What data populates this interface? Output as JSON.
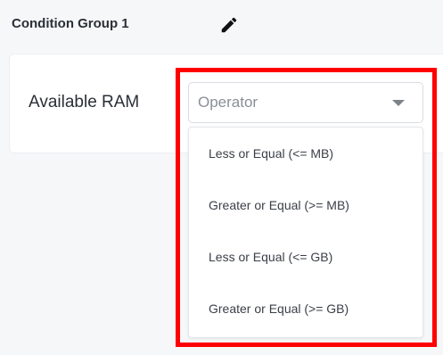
{
  "group": {
    "title": "Condition Group 1",
    "edit_icon": "pencil-icon"
  },
  "condition": {
    "label": "Available RAM",
    "operator_select": {
      "placeholder": "Operator",
      "caret_icon": "chevron-down-icon",
      "expanded": true,
      "options": [
        {
          "label": "Less or Equal (<= MB)"
        },
        {
          "label": "Greater or Equal (>= MB)"
        },
        {
          "label": "Less or Equal (<= GB)"
        },
        {
          "label": "Greater or Equal (>= GB)"
        }
      ]
    }
  },
  "highlight": {
    "color": "#ff0000"
  }
}
